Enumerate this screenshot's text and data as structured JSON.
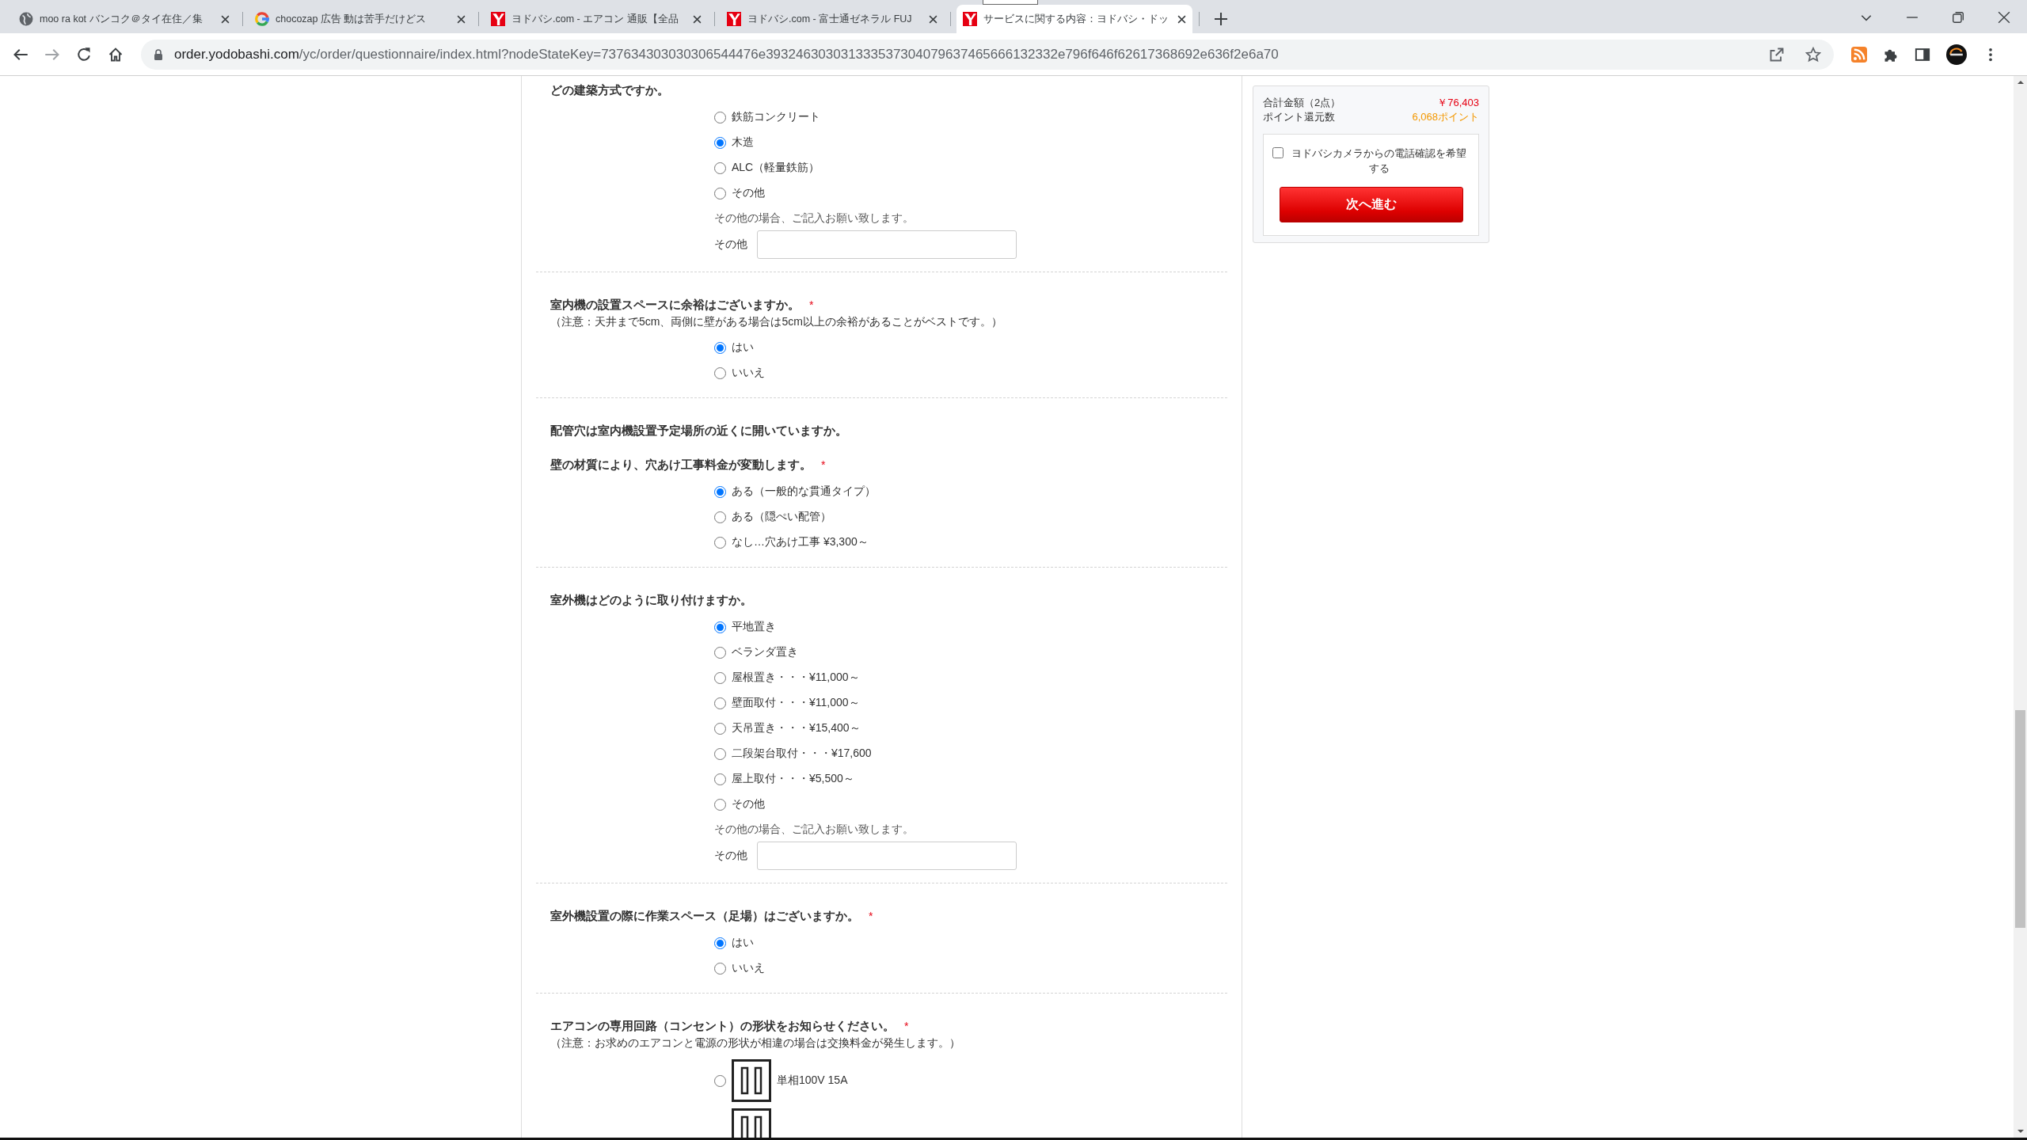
{
  "browser": {
    "tabs": [
      {
        "title": "moo ra kot バンコク＠タイ在住／集",
        "kind": "globe",
        "selected": false
      },
      {
        "title": "chocozap 広告 動は苦手だけどス",
        "kind": "ring",
        "selected": false
      },
      {
        "title": "ヨドバシ.com - エアコン 通販【全品",
        "kind": "site",
        "selected": false
      },
      {
        "title": "ヨドバシ.com - 富士通ゼネラル FUJ",
        "kind": "site",
        "selected": false
      },
      {
        "title": "サービスに関する内容：ヨドバシ・ドッ",
        "kind": "site",
        "selected": true
      }
    ],
    "url_host": "order.yodobashi.com",
    "url_path": "/yc/order/questionnaire/index.html?nodeStateKey=737634303030306544476e393246303031333537304079637465666132332e796f646f62617368692e636f2e6a70"
  },
  "questions": [
    {
      "headings": [
        {
          "text": "どの建築方式ですか。"
        }
      ],
      "options": [
        {
          "label": "鉄筋コンクリート",
          "selected": false
        },
        {
          "label": "木造",
          "selected": true
        },
        {
          "label": "ALC（軽量鉄筋）",
          "selected": false
        },
        {
          "label": "その他",
          "selected": false
        }
      ],
      "other_hint": "その他の場合、ご記入お願い致します。",
      "other_label": "その他"
    },
    {
      "headings": [
        {
          "text": "室内機の設置スペースに余裕はございますか。",
          "required_mark": "*"
        }
      ],
      "note": "（注意：天井まで5cm、両側に壁がある場合は5cm以上の余裕があることがベストです。）",
      "options": [
        {
          "label": "はい",
          "selected": true
        },
        {
          "label": "いいえ",
          "selected": false
        }
      ]
    },
    {
      "headings": [
        {
          "text": "配管穴は室内機設置予定場所の近くに開いていますか。"
        },
        {
          "text": "壁の材質により、穴あけ工事料金が変動します。",
          "required_mark": "*"
        }
      ],
      "options": [
        {
          "label": "ある（一般的な貫通タイプ）",
          "selected": true
        },
        {
          "label": "ある（隠ぺい配管）",
          "selected": false
        },
        {
          "label": "なし…穴あけ工事 ¥3,300～",
          "selected": false
        }
      ]
    },
    {
      "headings": [
        {
          "text": "室外機はどのように取り付けますか。"
        }
      ],
      "options": [
        {
          "label": "平地置き",
          "selected": true
        },
        {
          "label": "ベランダ置き",
          "selected": false
        },
        {
          "label": "屋根置き・・・¥11,000～",
          "selected": false
        },
        {
          "label": "壁面取付・・・¥11,000～",
          "selected": false
        },
        {
          "label": "天吊置き・・・¥15,400～",
          "selected": false
        },
        {
          "label": "二段架台取付・・・¥17,600",
          "selected": false
        },
        {
          "label": "屋上取付・・・¥5,500～",
          "selected": false
        },
        {
          "label": "その他",
          "selected": false
        }
      ],
      "other_hint": "その他の場合、ご記入お願い致します。",
      "other_label": "その他"
    },
    {
      "headings": [
        {
          "text": "室外機設置の際に作業スペース（足場）はございますか。",
          "required_mark": "*"
        }
      ],
      "options": [
        {
          "label": "はい",
          "selected": true
        },
        {
          "label": "いいえ",
          "selected": false
        }
      ]
    },
    {
      "headings": [
        {
          "text": "エアコンの専用回路（コンセント）の形状をお知らせください。",
          "required_mark": "*"
        }
      ],
      "note": "（注意：お求めのエアコンと電源の形状が相違の場合は交換料金が発生します。）",
      "options": [
        {
          "kind": "socket",
          "label": "単相100V 15A",
          "selected": false
        },
        {
          "kind": "socket"
        }
      ]
    }
  ],
  "summary": {
    "total_label": "合計金額（2点）",
    "total": "￥76,403",
    "points_label": "ポイント還元数",
    "points": "6,068ポイント",
    "phone_check": {
      "label": "ヨドバシカメラからの電話確認を希望する",
      "checked": false
    },
    "next_button": "次へ進む"
  }
}
